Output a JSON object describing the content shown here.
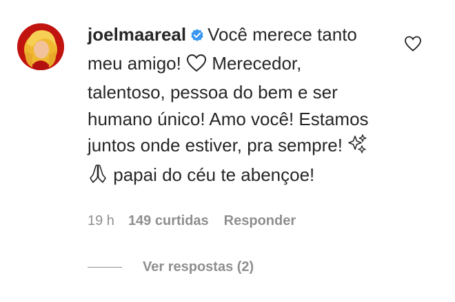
{
  "comment": {
    "username": "joelmaareal",
    "verified_icon": "verified-badge-icon",
    "text_part1": "Você merece tanto meu amigo!",
    "text_part2": "Merecedor, talentoso, pessoa do bem e ser humano único! Amo você! Estamos juntos onde estiver, pra sempre!",
    "text_part3": "papai do céu te abençoe!",
    "emoji_heart": "heart-emoji-icon",
    "emoji_sparkles": "sparkles-emoji-icon",
    "emoji_pray": "folded-hands-emoji-icon"
  },
  "meta": {
    "time": "19 h",
    "likes": "149 curtidas",
    "reply_label": "Responder"
  },
  "replies": {
    "view_label": "Ver respostas (2)"
  },
  "colors": {
    "text": "#262626",
    "secondary": "#8e8e8e",
    "verified": "#3897f0",
    "avatar_ring": "#c2140f"
  }
}
